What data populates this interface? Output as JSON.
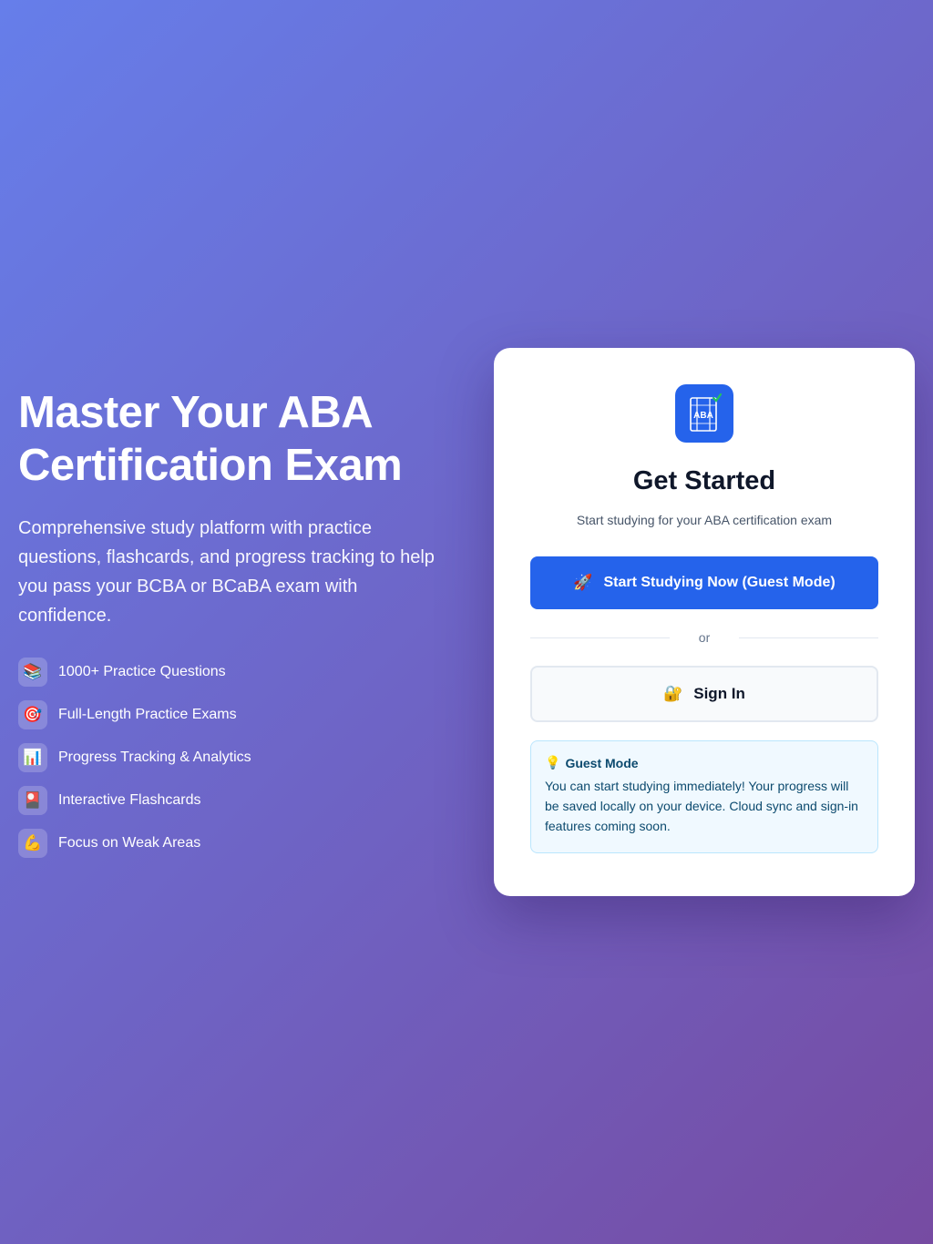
{
  "hero": {
    "title": "Master Your ABA Certification Exam",
    "subtitle": "Comprehensive study platform with practice questions, flashcards, and progress tracking to help you pass your BCBA or BCaBA exam with confidence.",
    "features": [
      {
        "icon": "books-icon",
        "glyph": "📚",
        "label": "1000+ Practice Questions"
      },
      {
        "icon": "target-icon",
        "glyph": "🎯",
        "label": "Full-Length Practice Exams"
      },
      {
        "icon": "bar-chart-icon",
        "glyph": "📊",
        "label": "Progress Tracking & Analytics"
      },
      {
        "icon": "flashcard-icon",
        "glyph": "🎴",
        "label": "Interactive Flashcards"
      },
      {
        "icon": "flexed-biceps-icon",
        "glyph": "💪",
        "label": "Focus on Weak Areas"
      }
    ]
  },
  "card": {
    "logo_text": "ABA",
    "title": "Get Started",
    "subtitle": "Start studying for your ABA certification exam",
    "primary_button": {
      "icon": "rocket-icon",
      "glyph": "🚀",
      "label": "Start Studying Now (Guest Mode)"
    },
    "divider_text": "or",
    "secondary_button": {
      "icon": "lock-icon",
      "glyph": "🔐",
      "label": "Sign In"
    },
    "info": {
      "icon": "lightbulb-icon",
      "glyph": "💡",
      "title": "Guest Mode",
      "text": "You can start studying immediately! Your progress will be saved locally on your device. Cloud sync and sign-in features coming soon."
    }
  },
  "colors": {
    "gradient_start": "#667eea",
    "gradient_end": "#764ba2",
    "primary": "#2563eb",
    "info_bg": "#f0f9ff",
    "info_text": "#0c4a6e"
  }
}
